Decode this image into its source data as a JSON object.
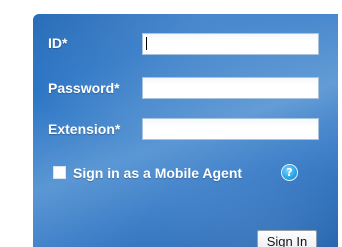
{
  "form": {
    "id_label": "ID*",
    "id_value": "",
    "password_label": "Password*",
    "password_value": "",
    "extension_label": "Extension*",
    "extension_value": "",
    "mobile_agent_label": "Sign in as a Mobile Agent",
    "mobile_agent_checked": false,
    "help_glyph": "?",
    "help_icon": "help-icon",
    "signin_label": "Sign In"
  },
  "colors": {
    "panel_blue": "#2a74c4",
    "label_text": "#ffffff",
    "help_icon": "#26a7ea"
  }
}
